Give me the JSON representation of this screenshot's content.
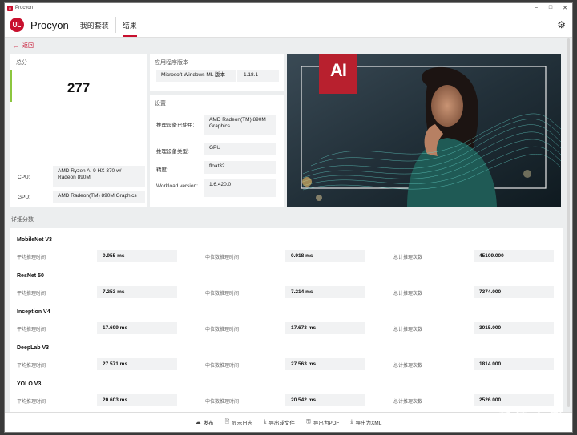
{
  "window": {
    "title": "Procyon",
    "controls": [
      "–",
      "□",
      "✕"
    ]
  },
  "nav": {
    "logo": "UL",
    "brand": "Procyon",
    "tabs": [
      {
        "label": "我的套装"
      },
      {
        "label": "结果"
      }
    ]
  },
  "back": {
    "label": "返回"
  },
  "score_panel": {
    "title": "总分",
    "score": "277",
    "cpu_label": "CPU:",
    "cpu_value": "AMD Ryzen AI 9 HX 370 w/ Radeon 890M",
    "gpu_label": "GPU:",
    "gpu_value": "AMD Radeon(TM) 890M Graphics"
  },
  "app_panel": {
    "title": "应用程序版本",
    "name": "Microsoft Windows ML 版本",
    "version": "1.18.1"
  },
  "settings_panel": {
    "title": "设置",
    "rows": [
      {
        "label": "推理设备已使用:",
        "value": "AMD Radeon(TM) 890M Graphics"
      },
      {
        "label": "推理设备类型:",
        "value": "GPU"
      },
      {
        "label": "精度:",
        "value": "float32"
      },
      {
        "label": "Workload version:",
        "value": "1.6.420.0"
      }
    ]
  },
  "hero": {
    "logo_text": "AI"
  },
  "details": {
    "title": "详细分数",
    "col_labels": [
      "平均推理时间",
      "中位数推理时间",
      "总计推理次数"
    ],
    "benchmarks": [
      {
        "name": "MobileNet V3",
        "avg": "0.955 ms",
        "median": "0.918 ms",
        "total": "45109.000"
      },
      {
        "name": "ResNet 50",
        "avg": "7.253 ms",
        "median": "7.214 ms",
        "total": "7374.000"
      },
      {
        "name": "Inception V4",
        "avg": "17.699 ms",
        "median": "17.673 ms",
        "total": "3015.000"
      },
      {
        "name": "DeepLab V3",
        "avg": "27.571 ms",
        "median": "27.563 ms",
        "total": "1814.000"
      },
      {
        "name": "YOLO V3",
        "avg": "20.603 ms",
        "median": "20.542 ms",
        "total": "2526.000"
      }
    ]
  },
  "footer": {
    "buttons": [
      {
        "label": "发布",
        "icon": "cloud-upload-icon"
      },
      {
        "label": "显示日志",
        "icon": "document-icon"
      },
      {
        "label": "导出成文件",
        "icon": "download-icon"
      },
      {
        "label": "导出为PDF",
        "icon": "save-icon"
      },
      {
        "label": "导出为XML",
        "icon": "download-icon"
      }
    ]
  },
  "watermark": "新 浪 众 测"
}
